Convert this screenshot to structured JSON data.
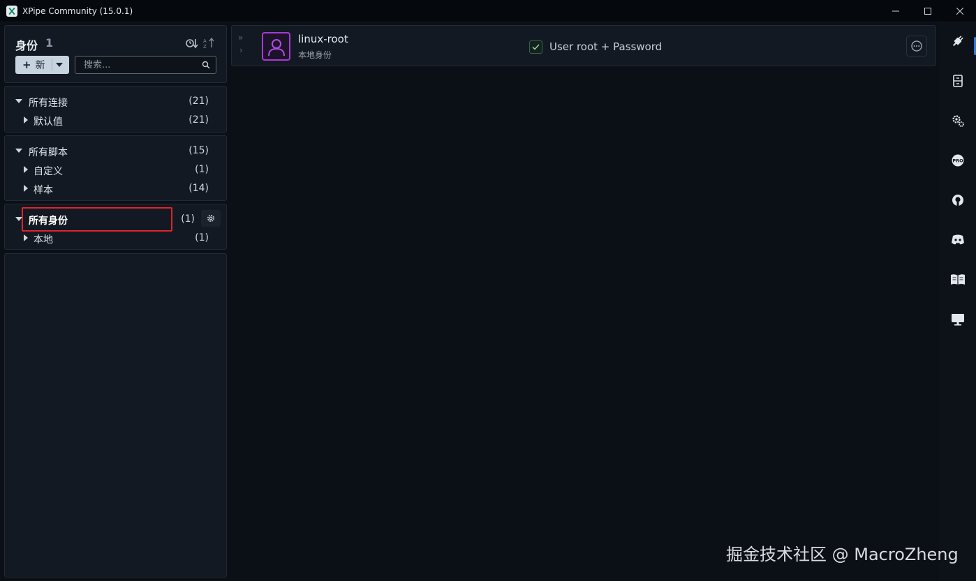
{
  "window": {
    "title": "XPipe Community (15.0.1)",
    "controls": [
      "minimize",
      "maximize",
      "close"
    ]
  },
  "header": {
    "title": "身份",
    "count": "1",
    "new_button_label": "新",
    "search_placeholder": "搜索..."
  },
  "categories": {
    "connections": {
      "label": "所有连接",
      "count": "(21)",
      "children": [
        {
          "label": "默认值",
          "count": "(21)"
        }
      ]
    },
    "scripts": {
      "label": "所有脚本",
      "count": "(15)",
      "children": [
        {
          "label": "自定义",
          "count": "(1)"
        },
        {
          "label": "样本",
          "count": "(14)"
        }
      ]
    },
    "identities": {
      "label": "所有身份",
      "count": "(1)",
      "selected": true,
      "children": [
        {
          "label": "本地",
          "count": "(1)"
        }
      ]
    }
  },
  "entry": {
    "name": "linux-root",
    "subtitle": "本地身份",
    "info": "User root + Password",
    "icon": "user-icon",
    "accent": "#a43bd8"
  },
  "rail": [
    {
      "icon": "plug-icon",
      "active": true
    },
    {
      "icon": "storage-icon"
    },
    {
      "icon": "gears-icon"
    },
    {
      "icon": "pro-badge-icon"
    },
    {
      "icon": "github-icon"
    },
    {
      "icon": "discord-icon"
    },
    {
      "icon": "book-icon"
    },
    {
      "icon": "monitor-icon"
    }
  ],
  "watermark": "掘金技术社区 @ MacroZheng"
}
